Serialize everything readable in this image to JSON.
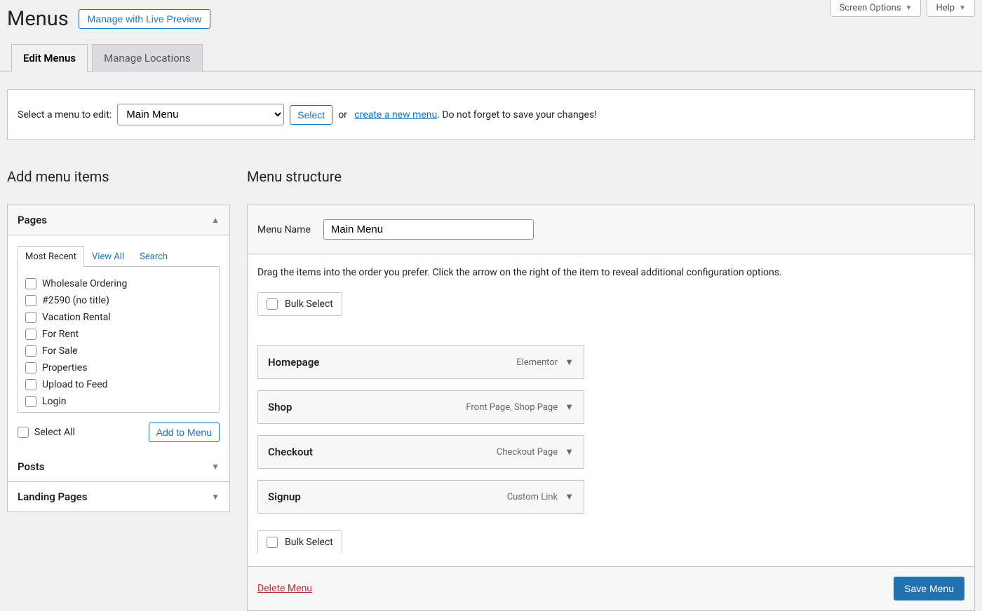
{
  "top_tabs": {
    "screen_options": "Screen Options",
    "help": "Help"
  },
  "header": {
    "title": "Menus",
    "live_preview_btn": "Manage with Live Preview"
  },
  "nav_tabs": {
    "edit_menus": "Edit Menus",
    "manage_locations": "Manage Locations"
  },
  "select_bar": {
    "label": "Select a menu to edit:",
    "selected": "Main Menu",
    "select_btn": "Select",
    "or": "or",
    "create_link": "create a new menu",
    "suffix": ". Do not forget to save your changes!"
  },
  "left": {
    "heading": "Add menu items",
    "panels": {
      "pages": "Pages",
      "posts": "Posts",
      "landing": "Landing Pages"
    },
    "inner_tabs": {
      "recent": "Most Recent",
      "view_all": "View All",
      "search": "Search"
    },
    "pages_list": [
      "Wholesale Ordering",
      "#2590 (no title)",
      "Vacation Rental",
      "For Rent",
      "For Sale",
      "Properties",
      "Upload to Feed",
      "Login"
    ],
    "select_all": "Select All",
    "add_to_menu": "Add to Menu"
  },
  "right": {
    "heading": "Menu structure",
    "menu_name_label": "Menu Name",
    "menu_name_value": "Main Menu",
    "help": "Drag the items into the order you prefer. Click the arrow on the right of the item to reveal additional configuration options.",
    "bulk": "Bulk Select",
    "items": [
      {
        "title": "Homepage",
        "type": "Elementor"
      },
      {
        "title": "Shop",
        "type": "Front Page, Shop Page"
      },
      {
        "title": "Checkout",
        "type": "Checkout Page"
      },
      {
        "title": "Signup",
        "type": "Custom Link"
      }
    ],
    "delete": "Delete Menu",
    "save": "Save Menu"
  }
}
